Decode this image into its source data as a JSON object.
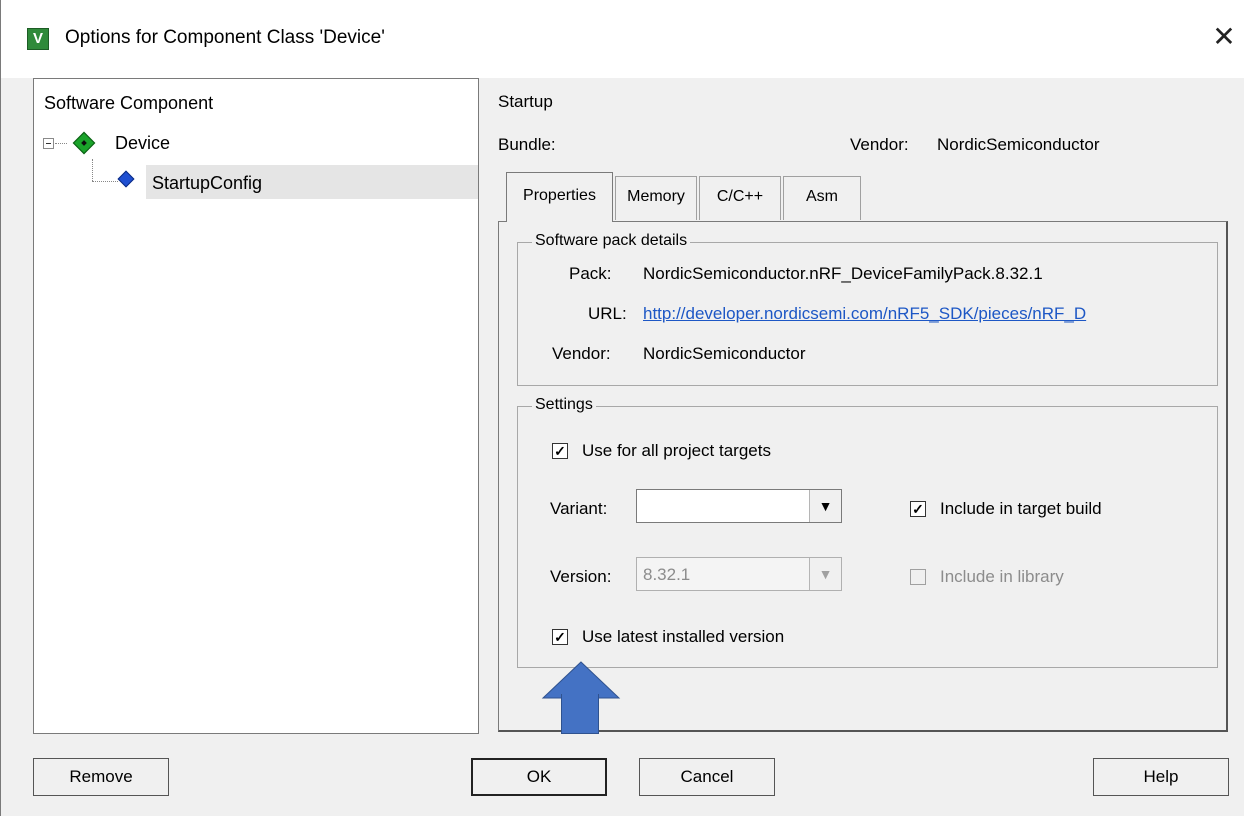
{
  "window": {
    "title": "Options for Component Class 'Device'",
    "app_icon_glyph": "V",
    "close_glyph": "✕"
  },
  "tree": {
    "header": "Software Component",
    "items": [
      {
        "label": "Device",
        "expanded": true
      },
      {
        "label": "StartupConfig",
        "selected": true
      }
    ]
  },
  "details": {
    "component_name": "Startup",
    "bundle_label": "Bundle:",
    "vendor_label": "Vendor:",
    "vendor_value": "NordicSemiconductor"
  },
  "tabs": [
    {
      "label": "Properties",
      "active": true
    },
    {
      "label": "Memory"
    },
    {
      "label": "C/C++"
    },
    {
      "label": "Asm"
    }
  ],
  "pack_group": {
    "legend": "Software pack details",
    "pack_label": "Pack:",
    "pack_value": "NordicSemiconductor.nRF_DeviceFamilyPack.8.32.1",
    "url_label": "URL:",
    "url_value": "http://developer.nordicsemi.com/nRF5_SDK/pieces/nRF_D",
    "vendor_label": "Vendor:",
    "vendor_value": "NordicSemiconductor"
  },
  "settings_group": {
    "legend": "Settings",
    "use_all_targets_label": "Use for all project targets",
    "variant_label": "Variant:",
    "variant_value": "",
    "include_build_label": "Include in target build",
    "version_label": "Version:",
    "version_value": "8.32.1",
    "include_library_label": "Include in library",
    "use_latest_label": "Use latest installed version",
    "check_glyph": "✓"
  },
  "buttons": {
    "remove": "Remove",
    "ok": "OK",
    "cancel": "Cancel",
    "help": "Help"
  },
  "annotation": {
    "arrow_color": "#4472c4"
  }
}
